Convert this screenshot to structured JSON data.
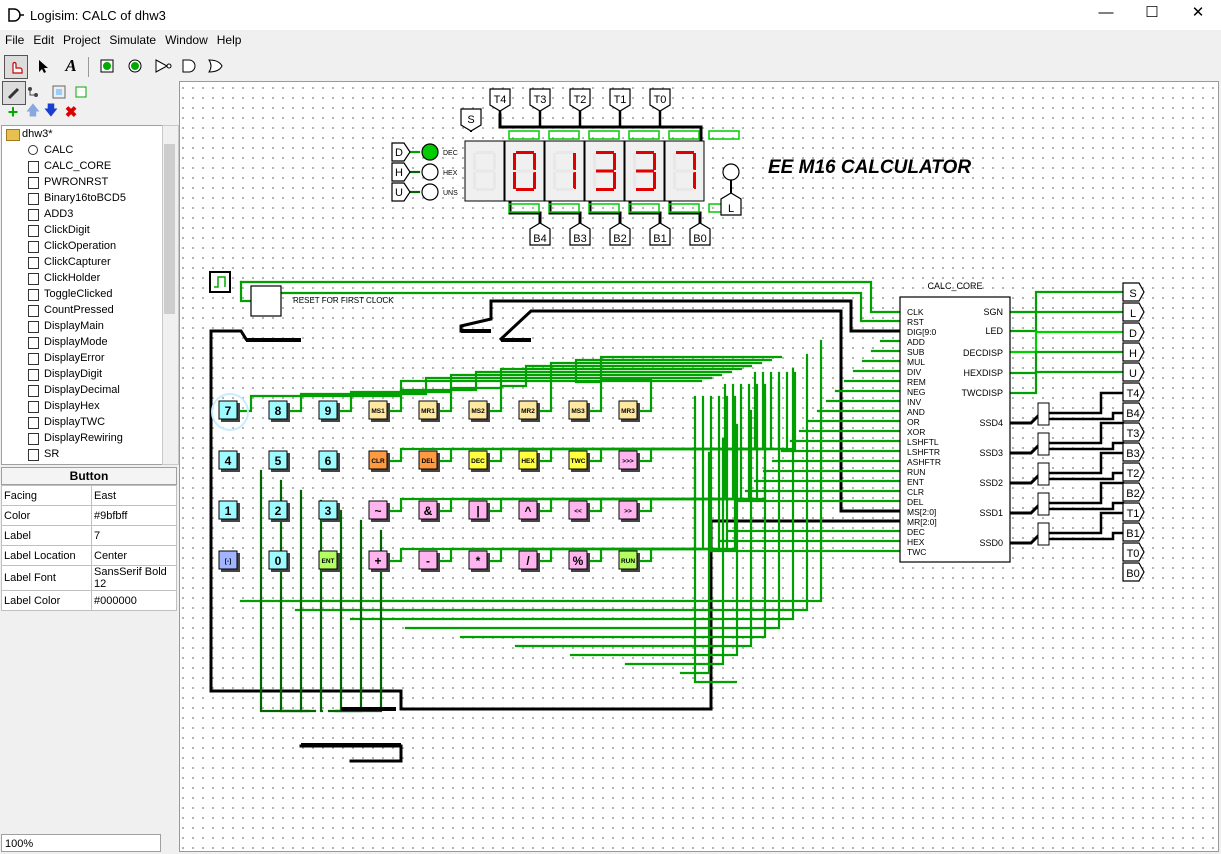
{
  "window": {
    "title": "Logisim: CALC of dhw3"
  },
  "menu": [
    "File",
    "Edit",
    "Project",
    "Simulate",
    "Window",
    "Help"
  ],
  "tree": {
    "root": "dhw3*",
    "items": [
      "CALC",
      "CALC_CORE",
      "PWRONRST",
      "Binary16toBCD5",
      "ADD3",
      "ClickDigit",
      "ClickOperation",
      "ClickCapturer",
      "ClickHolder",
      "ToggleClicked",
      "CountPressed",
      "DisplayMain",
      "DisplayMode",
      "DisplayError",
      "DisplayDigit",
      "DisplayDecimal",
      "DisplayHex",
      "DisplayTWC",
      "DisplayRewiring",
      "SR"
    ]
  },
  "props": {
    "title": "Button",
    "rows": [
      {
        "k": "Facing",
        "v": "East"
      },
      {
        "k": "Color",
        "v": "#9bfbff"
      },
      {
        "k": "Label",
        "v": "7"
      },
      {
        "k": "Label Location",
        "v": "Center"
      },
      {
        "k": "Label Font",
        "v": "SansSerif Bold 12"
      },
      {
        "k": "Label Color",
        "v": "#000000"
      }
    ]
  },
  "zoom": "100%",
  "circuit": {
    "title": "EE M16 CALCULATOR",
    "reset_label": "RESET FOR FIRST CLOCK",
    "display_digits": [
      "0",
      "1",
      "3",
      "3",
      "7"
    ],
    "top_pins": [
      "T4",
      "T3",
      "T2",
      "T1",
      "T0"
    ],
    "bottom_pins": [
      "B4",
      "B3",
      "B2",
      "B1",
      "B0"
    ],
    "mode_pins": [
      "D",
      "H",
      "U"
    ],
    "mode_labels": [
      "DEC",
      "HEX",
      "UNS"
    ],
    "s_pin": "S",
    "l_pin": "L",
    "core": {
      "name": "CALC_CORE",
      "inputs": [
        "CLK",
        "RST",
        "DIG[9:0",
        "ADD",
        "SUB",
        "MUL",
        "DIV",
        "REM",
        "NEG",
        "INV",
        "AND",
        "OR",
        "XOR",
        "LSHFTL",
        "LSHFTR",
        "ASHFTR",
        "RUN",
        "ENT",
        "CLR",
        "DEL",
        "MS[2:0]",
        "MR[2:0]",
        "DEC",
        "HEX",
        "TWC"
      ],
      "outputs": [
        "SGN",
        "LED",
        "DECDISP",
        "HEXDISP",
        "TWCDISP",
        "SSD4",
        "SSD3",
        "SSD2",
        "SSD1",
        "SSD0"
      ]
    },
    "right_pins": [
      "S",
      "L",
      "D",
      "H",
      "U",
      "T4",
      "B4",
      "T3",
      "B3",
      "T2",
      "B2",
      "T1",
      "B1",
      "T0",
      "B0"
    ],
    "buttons": [
      [
        "7",
        "8",
        "9",
        "MS1",
        "MR1",
        "MS2",
        "MR2",
        "MS3",
        "MR3"
      ],
      [
        "4",
        "5",
        "6",
        "CLR",
        "DEL",
        "DEC",
        "HEX",
        "TWC",
        ">>>"
      ],
      [
        "1",
        "2",
        "3",
        "~",
        "&",
        "|",
        "^",
        "<<",
        ">>"
      ],
      [
        "[-]",
        "0",
        "ENT",
        "+",
        "-",
        "*",
        "/",
        "%",
        "RUN"
      ]
    ],
    "colors": {
      "wire_green": "#00a000",
      "wire_bright": "#00d000",
      "wire_dark": "#006400",
      "digit_btn": "#9bfbff",
      "mem_btn": "#ffe8a0",
      "clr_btn": "#ff9a40",
      "dec_btn": "#ffff40",
      "op_btn": "#ffb4f0",
      "ent_btn": "#b4ff60",
      "neg_btn": "#a0b4ff",
      "seg_on": "#e00000",
      "seg_off": "#e8e8e8"
    }
  }
}
